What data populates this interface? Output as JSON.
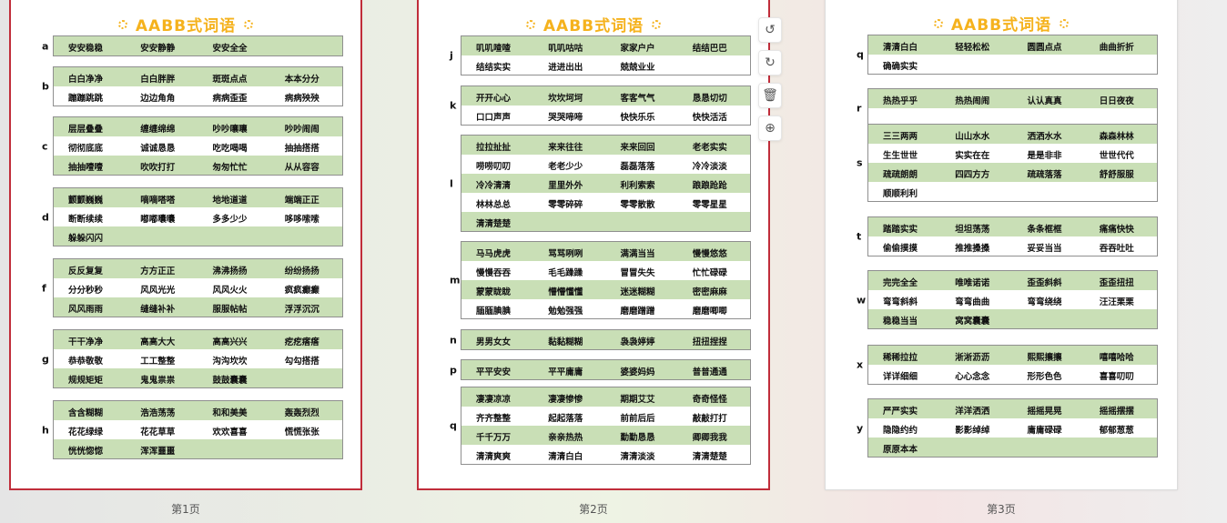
{
  "pages": [
    {
      "title": "AABB式词语",
      "label": "第1页",
      "groups": [
        {
          "letter": "a",
          "rows": [
            [
              "安安稳稳",
              "安安静静",
              "安安全全",
              ""
            ]
          ]
        },
        {
          "letter": "b",
          "rows": [
            [
              "白白净净",
              "白白胖胖",
              "斑斑点点",
              "本本分分"
            ],
            [
              "蹦蹦跳跳",
              "边边角角",
              "病病歪歪",
              "病病殃殃"
            ]
          ]
        },
        {
          "letter": "c",
          "rows": [
            [
              "层层叠叠",
              "缠缠绵绵",
              "吵吵嚷嚷",
              "吵吵闹闹"
            ],
            [
              "彻彻底底",
              "诚诚恳恳",
              "吃吃喝喝",
              "抽抽搭搭"
            ],
            [
              "抽抽噎噎",
              "吹吹打打",
              "匆匆忙忙",
              "从从容容"
            ]
          ]
        },
        {
          "letter": "d",
          "rows": [
            [
              "颤颤巍巍",
              "嘀嘀嗒嗒",
              "地地道道",
              "端端正正"
            ],
            [
              "断断续续",
              "嘟嘟囔囔",
              "多多少少",
              "哆哆嗦嗦"
            ],
            [
              "躲躲闪闪",
              "",
              "",
              ""
            ]
          ]
        },
        {
          "letter": "f",
          "rows": [
            [
              "反反复复",
              "方方正正",
              "沸沸扬扬",
              "纷纷扬扬"
            ],
            [
              "分分秒秒",
              "风风光光",
              "风风火火",
              "疯疯癫癫"
            ],
            [
              "风风雨雨",
              "缝缝补补",
              "服服帖帖",
              "浮浮沉沉"
            ]
          ]
        },
        {
          "letter": "g",
          "rows": [
            [
              "干干净净",
              "高高大大",
              "高高兴兴",
              "疙疙瘩瘩"
            ],
            [
              "恭恭敬敬",
              "工工整整",
              "沟沟坎坎",
              "勾勾搭搭"
            ],
            [
              "规规矩矩",
              "鬼鬼祟祟",
              "鼓鼓囊囊",
              ""
            ]
          ]
        },
        {
          "letter": "h",
          "rows": [
            [
              "含含糊糊",
              "浩浩荡荡",
              "和和美美",
              "轰轰烈烈"
            ],
            [
              "花花绿绿",
              "花花草草",
              "欢欢喜喜",
              "慌慌张张"
            ],
            [
              "恍恍惚惚",
              "浑浑噩噩",
              "",
              ""
            ]
          ]
        }
      ]
    },
    {
      "title": "AABB式词语",
      "label": "第2页",
      "groups": [
        {
          "letter": "j",
          "rows": [
            [
              "叽叽喳喳",
              "叽叽咕咕",
              "家家户户",
              "结结巴巴"
            ],
            [
              "结结实实",
              "进进出出",
              "兢兢业业",
              ""
            ]
          ]
        },
        {
          "letter": "k",
          "rows": [
            [
              "开开心心",
              "坎坎坷坷",
              "客客气气",
              "恳恳切切"
            ],
            [
              "口口声声",
              "哭哭啼啼",
              "快快乐乐",
              "快快活活"
            ]
          ]
        },
        {
          "letter": "l",
          "rows": [
            [
              "拉拉扯扯",
              "来来往往",
              "来来回回",
              "老老实实"
            ],
            [
              "唠唠叨叨",
              "老老少少",
              "磊磊落落",
              "冷冷淡淡"
            ],
            [
              "冷冷清清",
              "里里外外",
              "利利索索",
              "踉踉跄跄"
            ],
            [
              "林林总总",
              "零零碎碎",
              "零零散散",
              "零零星星"
            ],
            [
              "清清楚楚",
              "",
              "",
              ""
            ]
          ]
        },
        {
          "letter": "m",
          "rows": [
            [
              "马马虎虎",
              "骂骂咧咧",
              "满满当当",
              "慢慢悠悠"
            ],
            [
              "慢慢吞吞",
              "毛毛躁躁",
              "冒冒失失",
              "忙忙碌碌"
            ],
            [
              "蒙蒙眬眬",
              "懵懵懂懂",
              "迷迷糊糊",
              "密密麻麻"
            ],
            [
              "腼腼腆腆",
              "勉勉强强",
              "磨磨蹭蹭",
              "磨磨唧唧"
            ]
          ]
        },
        {
          "letter": "n",
          "rows": [
            [
              "男男女女",
              "黏黏糊糊",
              "袅袅婷婷",
              "扭扭捏捏"
            ]
          ]
        },
        {
          "letter": "p",
          "rows": [
            [
              "平平安安",
              "平平庸庸",
              "婆婆妈妈",
              "普普通通"
            ]
          ]
        },
        {
          "letter": "q",
          "rows": [
            [
              "凄凄凉凉",
              "凄凄惨惨",
              "期期艾艾",
              "奇奇怪怪"
            ],
            [
              "齐齐整整",
              "起起落落",
              "前前后后",
              "敲敲打打"
            ],
            [
              "千千万万",
              "亲亲热热",
              "勤勤恳恳",
              "卿卿我我"
            ],
            [
              "清清爽爽",
              "清清白白",
              "清清淡淡",
              "清清楚楚"
            ]
          ]
        }
      ]
    },
    {
      "title": "AABB式词语",
      "label": "第3页",
      "groups": [
        {
          "letter": "q",
          "rows": [
            [
              "清清白白",
              "轻轻松松",
              "圆圆点点",
              "曲曲折折"
            ],
            [
              "确确实实",
              "",
              "",
              ""
            ]
          ]
        },
        {
          "letter": "r",
          "rows": [
            [
              "热热乎乎",
              "热热闹闹",
              "认认真真",
              "日日夜夜"
            ],
            [
              "",
              "",
              "",
              ""
            ]
          ]
        },
        {
          "letter": "s",
          "rows": [
            [
              "三三两两",
              "山山水水",
              "洒洒水水",
              "森森林林"
            ],
            [
              "生生世世",
              "实实在在",
              "是是非非",
              "世世代代"
            ],
            [
              "疏疏朗朗",
              "四四方方",
              "疏疏落落",
              "舒舒服服"
            ],
            [
              "顺顺利利",
              "",
              "",
              ""
            ]
          ]
        },
        {
          "letter": "t",
          "rows": [
            [
              "踏踏实实",
              "坦坦荡荡",
              "条条框框",
              "痛痛快快"
            ],
            [
              "偷偷摸摸",
              "推推搡搡",
              "妥妥当当",
              "吞吞吐吐"
            ]
          ]
        },
        {
          "letter": "w",
          "rows": [
            [
              "完完全全",
              "唯唯诺诺",
              "歪歪斜斜",
              "歪歪扭扭"
            ],
            [
              "弯弯斜斜",
              "弯弯曲曲",
              "弯弯绕绕",
              "汪汪栗栗"
            ],
            [
              "稳稳当当",
              "窝窝囊囊",
              "",
              ""
            ]
          ]
        },
        {
          "letter": "x",
          "rows": [
            [
              "稀稀拉拉",
              "淅淅沥沥",
              "熙熙攘攘",
              "嘻嘻哈哈"
            ],
            [
              "详详细细",
              "心心念念",
              "形形色色",
              "喜喜叨叨"
            ]
          ]
        },
        {
          "letter": "y",
          "rows": [
            [
              "严严实实",
              "洋洋洒洒",
              "摇摇晃晃",
              "摇摇摆摆"
            ],
            [
              "隐隐约约",
              "影影绰绰",
              "庸庸碌碌",
              "郁郁葱葱"
            ],
            [
              "原原本本",
              "",
              "",
              ""
            ]
          ]
        }
      ]
    }
  ],
  "toolbar": {
    "tools": [
      {
        "name": "rotate-left-icon",
        "glyph": "↺"
      },
      {
        "name": "rotate-right-icon",
        "glyph": "↻"
      },
      {
        "name": "delete-icon",
        "glyph": "🗑"
      },
      {
        "name": "add-icon",
        "glyph": "⊕"
      }
    ]
  }
}
